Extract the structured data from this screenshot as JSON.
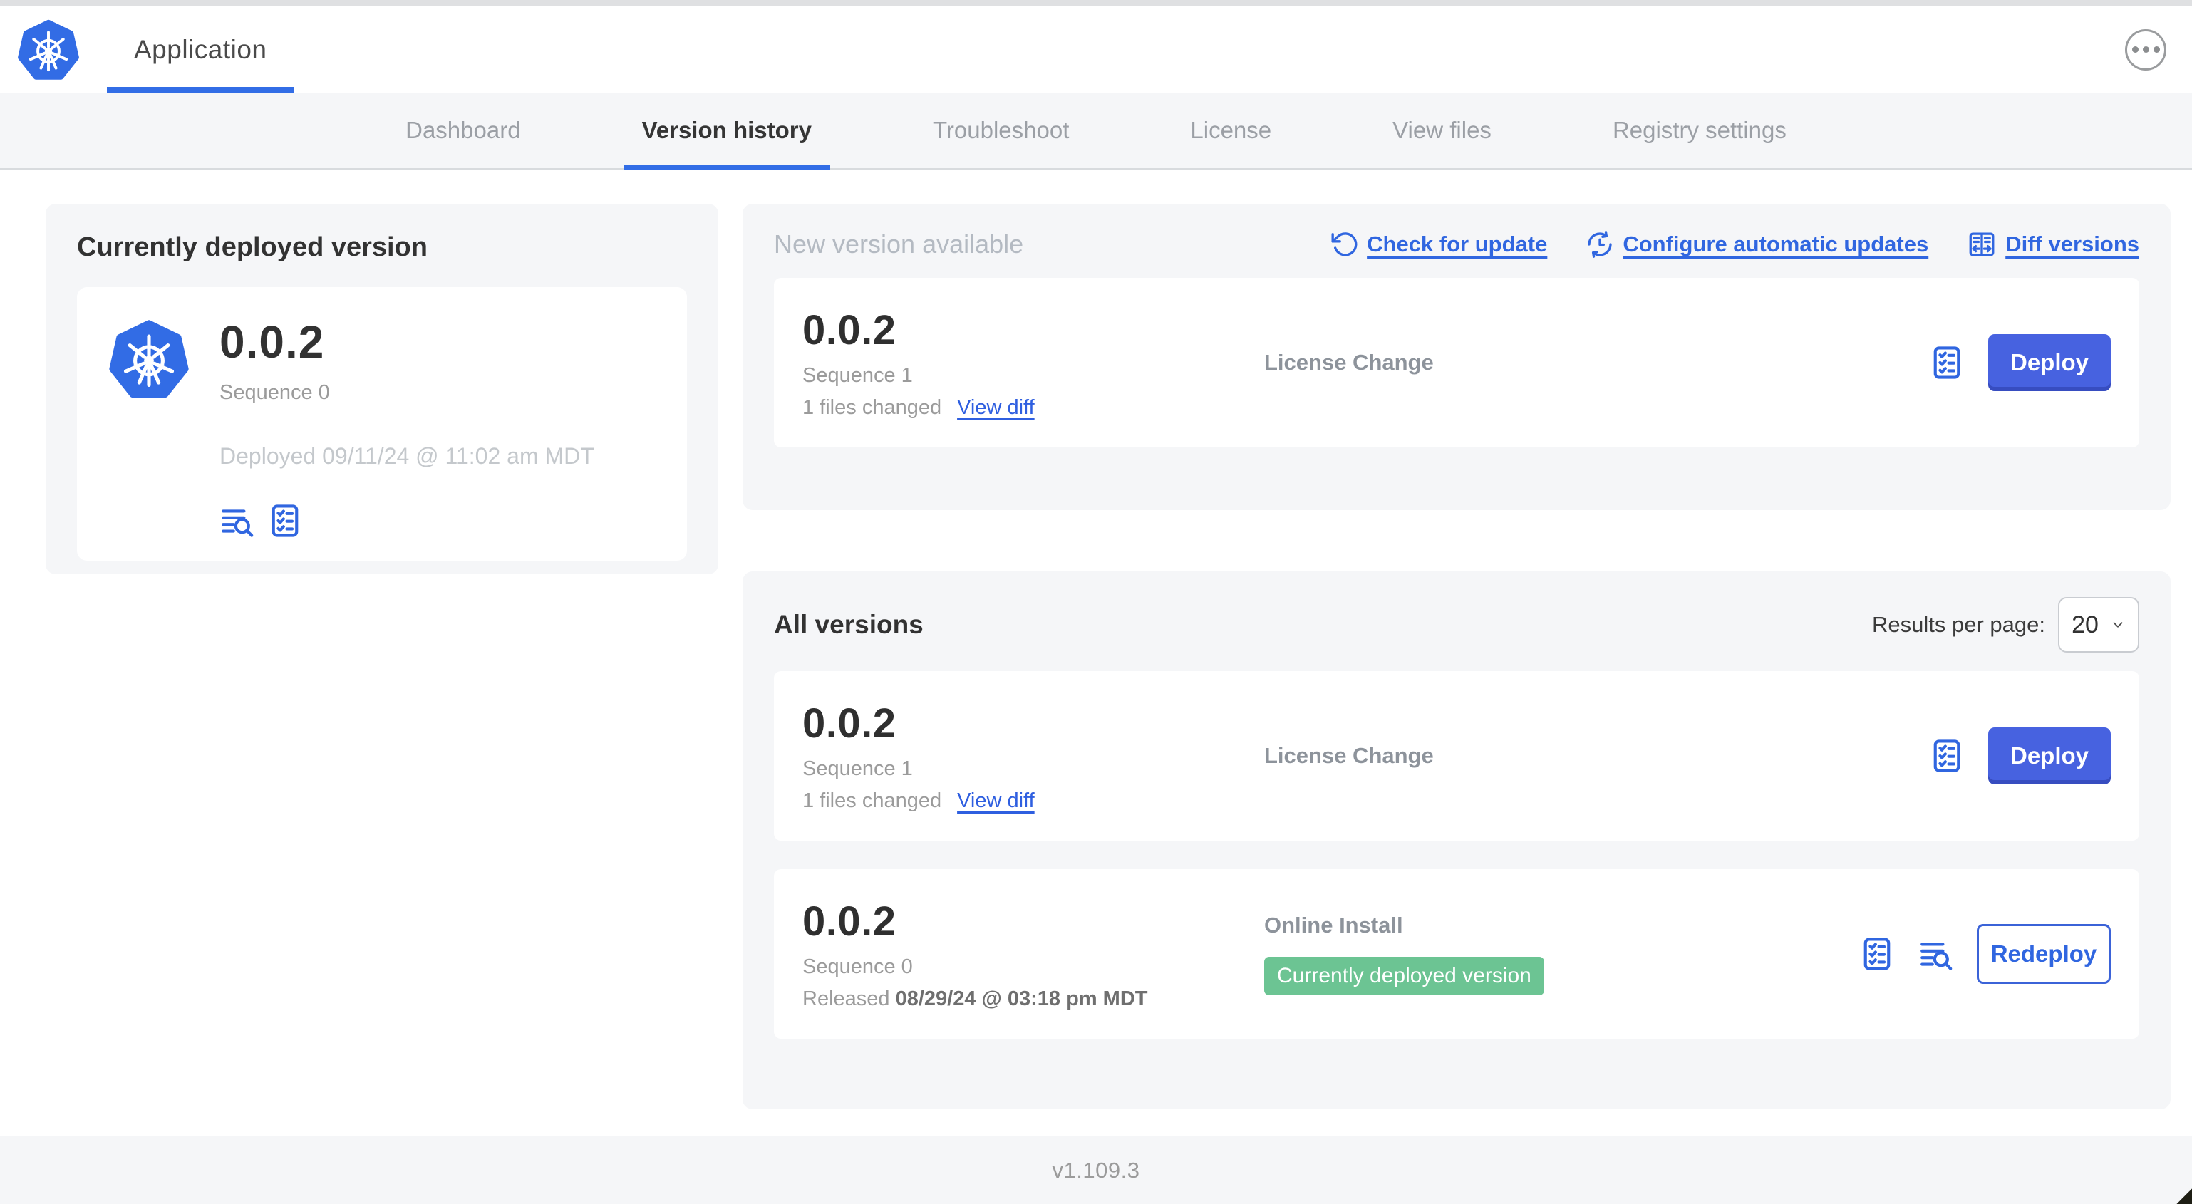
{
  "header": {
    "app_tab_label": "Application"
  },
  "nav": {
    "tabs": [
      {
        "label": "Dashboard"
      },
      {
        "label": "Version history"
      },
      {
        "label": "Troubleshoot"
      },
      {
        "label": "License"
      },
      {
        "label": "View files"
      },
      {
        "label": "Registry settings"
      }
    ]
  },
  "current_version_card": {
    "title": "Currently deployed version",
    "version": "0.0.2",
    "sequence": "Sequence 0",
    "deployed": "Deployed 09/11/24 @ 11:02 am MDT"
  },
  "new_version_panel": {
    "title": "New version available",
    "actions": {
      "check_for_update": "Check for update",
      "configure_automatic_updates": "Configure automatic updates",
      "diff_versions": "Diff versions"
    },
    "row": {
      "version": "0.0.2",
      "sequence": "Sequence 1",
      "files_changed": "1 files changed",
      "view_diff": "View diff",
      "source": "License Change",
      "action_label": "Deploy"
    }
  },
  "all_versions_panel": {
    "title": "All versions",
    "results_per_page_label": "Results per page:",
    "results_per_page_value": "20",
    "rows": [
      {
        "version": "0.0.2",
        "sequence": "Sequence 1",
        "files_changed": "1 files changed",
        "view_diff": "View diff",
        "source": "License Change",
        "action_label": "Deploy"
      },
      {
        "version": "0.0.2",
        "sequence": "Sequence 0",
        "released_prefix": "Released",
        "released_date": "08/29/24 @ 03:18 pm MDT",
        "source": "Online Install",
        "badge": "Currently deployed version",
        "action_label": "Redeploy"
      }
    ]
  },
  "footer": {
    "app_version": "v1.109.3"
  },
  "icons": {
    "brand": "kubernetes-logo",
    "more_menu": "ellipsis-icon",
    "check_for_update": "rotate-ccw-icon",
    "configure_automatic_updates": "auto-update-clock-icon",
    "diff_versions": "diff-columns-icon",
    "logs": "logs-search-icon",
    "preflight": "preflight-checklist-icon",
    "select": "chevron-down-icon"
  },
  "colors": {
    "accent_blue": "#3066e0",
    "tab_underline_blue": "#326de6",
    "kubernetes_blue": "#326ce5",
    "button_blue": "#4762e0",
    "badge_green": "#6cc493",
    "panel_background": "#f5f6f8",
    "muted_text": "#9b9b9b",
    "faint_text": "#c4c8cc",
    "dark_text": "#323232"
  }
}
